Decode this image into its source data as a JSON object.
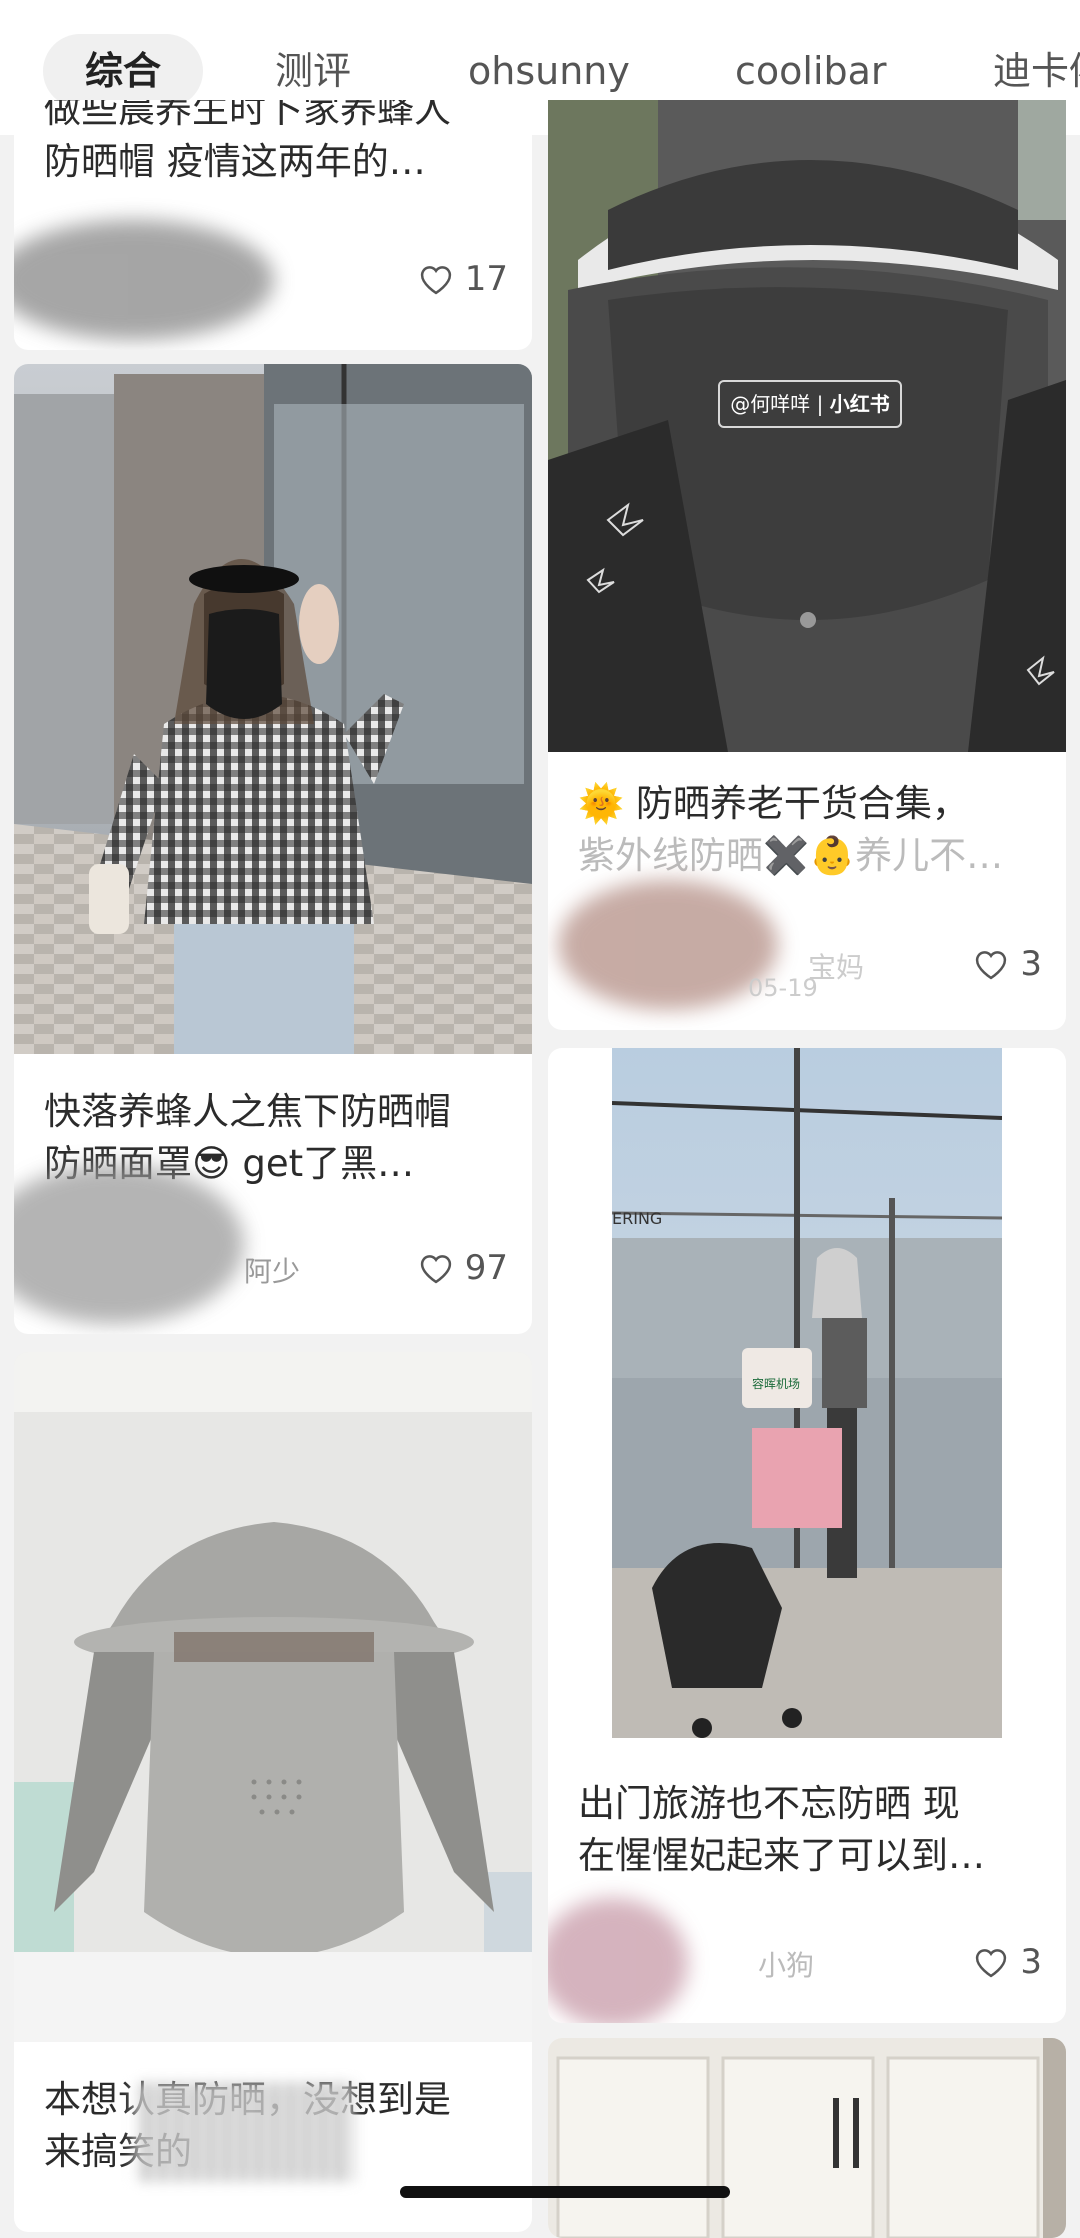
{
  "tabs": [
    "综合",
    "测评",
    "ohsunny",
    "coolibar",
    "迪卡侬"
  ],
  "watermark": {
    "user": "@何咩咩",
    "brand": "小红书"
  },
  "cards": {
    "c1": {
      "title_l1": "做些晨养生时卜家养蜂人",
      "title_l2": "防晒帽 疫情这两年的…",
      "likes": "17"
    },
    "c2": {
      "title_l1": "快落养蜂人之焦下防晒帽",
      "title_l2": "防晒面罩😎 get了黑…",
      "author": "阿少",
      "likes": "97"
    },
    "c3": {
      "title_l1": "本想认真防晒，没想到是",
      "title_l2": "来搞笑的"
    },
    "c4": {
      "title_l1": "🌞 防晒养老干货合集，",
      "title_l2": "紫外线防晒✖️👶养儿不…",
      "author": "宝妈",
      "date": "05-19",
      "likes": "3"
    },
    "c5": {
      "title_l1": "出门旅游也不忘防晒 现",
      "title_l2": "在惺惺妃起来了可以到…",
      "author": "小狗",
      "likes": "3"
    }
  },
  "photo_labels": {
    "airport_sign": "ERING",
    "trolley_sign": "容晖机场"
  }
}
